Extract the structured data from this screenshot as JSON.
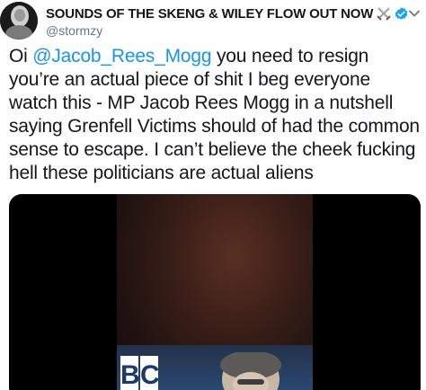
{
  "author": {
    "display_name": "SOUNDS OF THE SKENG & WILEY FLOW OUT NOW",
    "handle": "@stormzy",
    "emoji": "crossed-swords",
    "verified": true
  },
  "tweet": {
    "text_prefix": "Oi ",
    "mention": "@Jacob_Rees_Mogg",
    "text_body": " you need to resign you’re an actual piece of shit I beg everyone watch this - MP Jacob Rees Mogg in a nutshell saying Grenfell Victims should of had the common sense to escape. I can’t believe the cheek fucking hell these politicians are actual aliens"
  },
  "media": {
    "logo_letters": [
      "B",
      "C"
    ]
  },
  "colors": {
    "link": "#1b95e0",
    "verified": "#1da1f2",
    "secondary_text": "#657786"
  }
}
